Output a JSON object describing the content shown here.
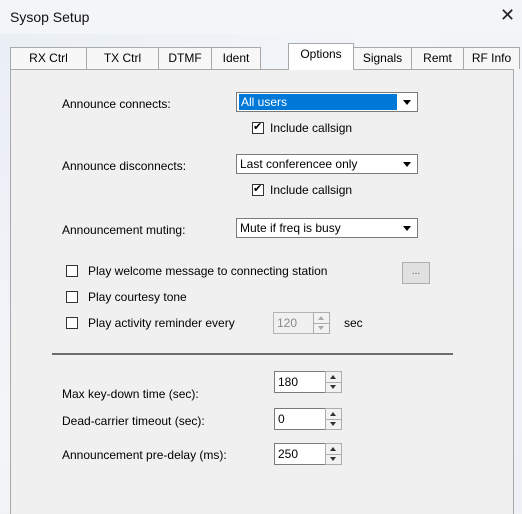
{
  "window": {
    "title": "Sysop Setup",
    "close_glyph": "✕"
  },
  "tabs": [
    {
      "label": "RX Ctrl",
      "active": false
    },
    {
      "label": "TX Ctrl",
      "active": false
    },
    {
      "label": "DTMF",
      "active": false
    },
    {
      "label": "Ident",
      "active": false
    },
    {
      "label": "Options",
      "active": true
    },
    {
      "label": "Signals",
      "active": false
    },
    {
      "label": "Remt",
      "active": false
    },
    {
      "label": "RF Info",
      "active": false
    }
  ],
  "options": {
    "announce_connects": {
      "label": "Announce connects:",
      "value": "All users",
      "include_callsign": {
        "label": "Include callsign",
        "checked": true
      }
    },
    "announce_disconnects": {
      "label": "Announce disconnects:",
      "value": "Last conferencee only",
      "include_callsign": {
        "label": "Include callsign",
        "checked": true
      }
    },
    "announcement_muting": {
      "label": "Announcement muting:",
      "value": "Mute if freq is busy"
    },
    "play_welcome": {
      "label": "Play welcome message to connecting station",
      "checked": false,
      "browse_label": "..."
    },
    "play_courtesy": {
      "label": "Play courtesy tone",
      "checked": false
    },
    "play_reminder": {
      "label": "Play activity reminder every",
      "checked": false,
      "value": "120",
      "unit": "sec"
    },
    "max_keydown": {
      "label": "Max key-down time (sec):",
      "value": "180"
    },
    "dead_carrier": {
      "label": "Dead-carrier timeout (sec):",
      "value": "0"
    },
    "predelay": {
      "label": "Announcement pre-delay (ms):",
      "value": "250"
    }
  }
}
